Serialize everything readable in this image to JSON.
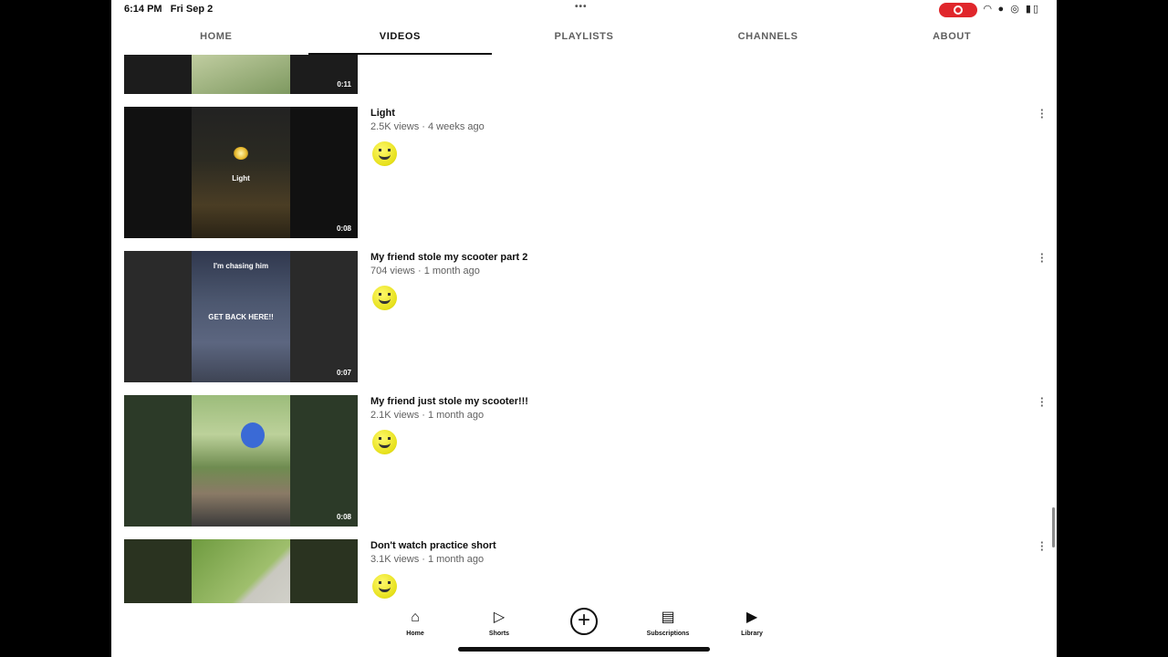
{
  "status_bar": {
    "time": "6:14 PM",
    "date": "Fri Sep 2",
    "dots": "•••",
    "icons": "wifi-icon battery-icon"
  },
  "tabs": [
    {
      "label": "HOME"
    },
    {
      "label": "VIDEOS"
    },
    {
      "label": "PLAYLISTS"
    },
    {
      "label": "CHANNELS"
    },
    {
      "label": "ABOUT"
    }
  ],
  "active_tab": "VIDEOS",
  "videos": [
    {
      "title": "",
      "stats": "",
      "duration": "0:11",
      "captions": []
    },
    {
      "title": "Light",
      "stats": "2.5K views · 4 weeks ago",
      "duration": "0:08",
      "captions": [
        "Light"
      ]
    },
    {
      "title": "My friend stole my scooter part 2",
      "stats": "704 views · 1 month ago",
      "duration": "0:07",
      "captions": [
        "I'm chasing him",
        "GET BACK HERE!!"
      ]
    },
    {
      "title": "My friend  just stole my scooter!!!",
      "stats": "2.1K views · 1 month ago",
      "duration": "0:08",
      "captions": []
    },
    {
      "title": "Don't watch  practice short",
      "stats": "3.1K views · 1 month ago",
      "duration": "",
      "captions": []
    }
  ],
  "bottom_nav": [
    {
      "label": "Home",
      "icon": "home-icon"
    },
    {
      "label": "Shorts",
      "icon": "shorts-icon"
    },
    {
      "label": "",
      "icon": "create-icon"
    },
    {
      "label": "Subscriptions",
      "icon": "subscriptions-icon"
    },
    {
      "label": "Library",
      "icon": "library-icon"
    }
  ],
  "colors": {
    "record_indicator": "#e0262b",
    "avatar": "#e6e01a",
    "text_primary": "#0f0f0f",
    "text_secondary": "#606060"
  }
}
